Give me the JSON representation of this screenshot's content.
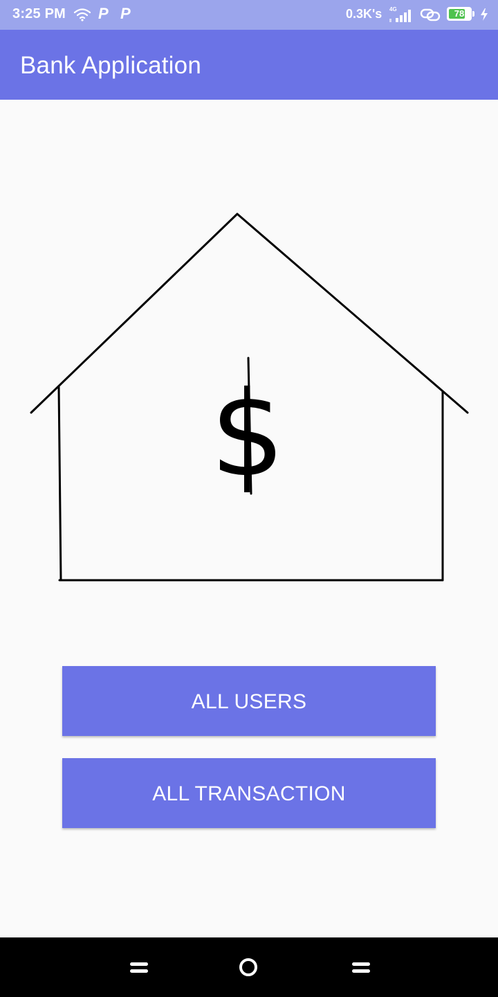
{
  "status_bar": {
    "time": "3:25 PM",
    "notif_1": "P",
    "notif_2": "P",
    "net_speed": "0.3K's",
    "network_type": "4G",
    "battery_level": 78,
    "battery_text": "78",
    "bg_color": "#9ba5ec",
    "icons": [
      "wifi-icon",
      "parking-notification-icon",
      "parking-notification-icon",
      "signal-icon",
      "link-icon",
      "battery-icon",
      "charging-icon"
    ]
  },
  "app_bar": {
    "title": "Bank Application",
    "bg_color": "#6b73e6"
  },
  "illustration": {
    "icon": "bank-house-icon",
    "symbol": "$"
  },
  "buttons": {
    "all_users": "ALL USERS",
    "all_transaction": "ALL TRANSACTION",
    "color": "#6b73e6"
  },
  "nav_bar": {
    "icons": [
      "menu-icon",
      "home-icon",
      "back-icon"
    ]
  }
}
